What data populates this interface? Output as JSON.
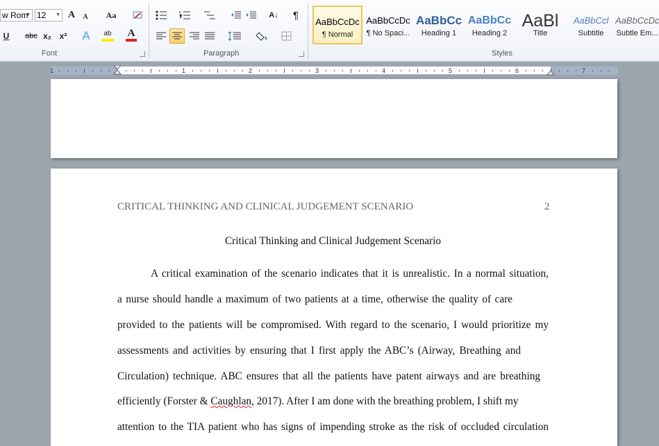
{
  "font_group": {
    "font_name": "w Rom",
    "font_size": "12",
    "label": "Font",
    "grow_label": "A",
    "shrink_label": "A",
    "case_label": "Aa",
    "underline_label": "U",
    "strike_label": "abc",
    "subscript_label": "x₂",
    "superscript_label": "x²",
    "effects_label": "A",
    "highlight_label": "ab",
    "color_label": "A"
  },
  "paragraph_group": {
    "label": "Paragraph",
    "sort_label": "A↓",
    "pilcrow": "¶"
  },
  "styles_group": {
    "label": "Styles",
    "items": [
      {
        "sample": "AaBbCcDc",
        "name": "¶ Normal"
      },
      {
        "sample": "AaBbCcDc",
        "name": "¶ No Spaci..."
      },
      {
        "sample": "AaBbCc",
        "name": "Heading 1"
      },
      {
        "sample": "AaBbCc",
        "name": "Heading 2"
      },
      {
        "sample": "AaBl",
        "name": "Title"
      },
      {
        "sample": "AaBbCcl",
        "name": "Subtitle"
      },
      {
        "sample": "AaBbCcDc",
        "name": "Subtle Em..."
      }
    ]
  },
  "ruler": {
    "numbers": [
      "1",
      "1",
      "2",
      "3",
      "4",
      "5",
      "6",
      "7"
    ]
  },
  "document": {
    "running_head": "CRITICAL THINKING AND CLINICAL JUDGEMENT SCENARIO",
    "page_number": "2",
    "title": "Critical Thinking and Clinical Judgement Scenario",
    "lines": [
      "A critical examination of the scenario indicates that it is unrealistic.  In a normal situation,",
      "a nurse should handle a maximum  of two patients at a time, otherwise the quality of care",
      "provided to the patients will be compromised. With regard to the scenario, I would prioritize my",
      "assessments and activities by ensuring that I first apply the ABC’s (Airway, Breathing and",
      "Circulation) technique. ABC ensures that all the patients have patent airways and are breathing",
      "efficiently (Forster & ",
      "attention to the TIA patient who has signs of impending stroke as the risk of occluded circulation"
    ],
    "cite_name": "Caughlan",
    "cite_rest": ", 2017).  After I am done with the breathing problem, I shift my"
  }
}
